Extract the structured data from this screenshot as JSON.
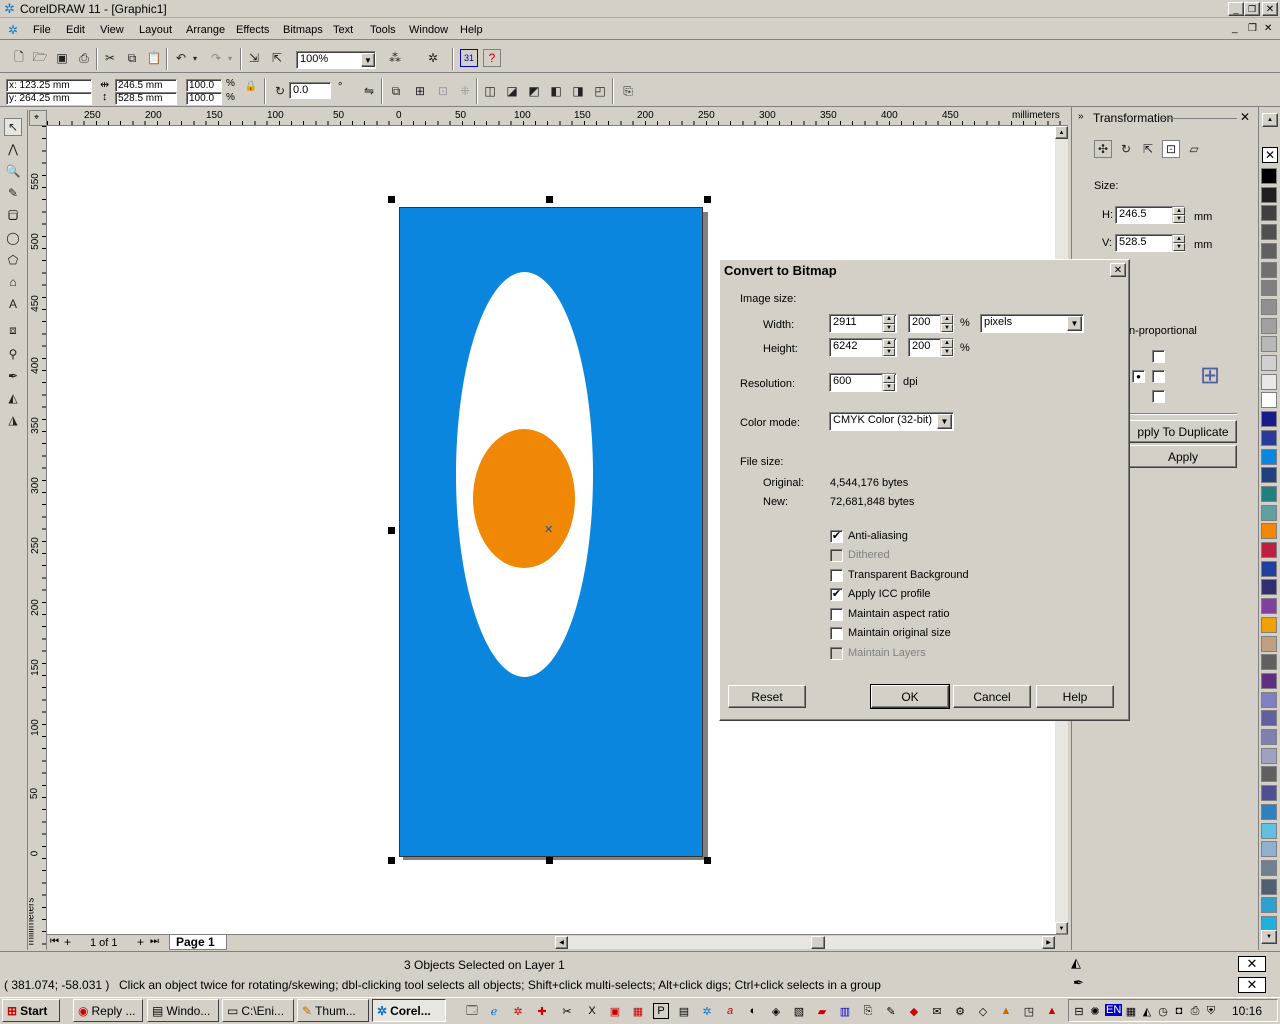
{
  "app": {
    "title": "CorelDRAW 11 - [Graphic1]"
  },
  "menu": [
    "File",
    "Edit",
    "View",
    "Layout",
    "Arrange",
    "Effects",
    "Bitmaps",
    "Text",
    "Tools",
    "Window",
    "Help"
  ],
  "toolbar": {
    "zoom": "100%"
  },
  "propbar": {
    "x": "x: 123.25 mm",
    "y": "y: 264.25 mm",
    "w": "246.5 mm",
    "h": "528.5 mm",
    "sx": "100.0",
    "sy": "100.0",
    "pct": "%",
    "angle": "0.0",
    "deg": "°"
  },
  "ruler": {
    "units": "millimeters",
    "h_ticks": [
      "250",
      "200",
      "150",
      "100",
      "50",
      "0",
      "50",
      "100",
      "150",
      "200",
      "250",
      "300",
      "350",
      "400",
      "450"
    ],
    "v_ticks": [
      "550",
      "500",
      "450",
      "400",
      "350",
      "300",
      "250",
      "200",
      "150",
      "100",
      "50",
      "0"
    ]
  },
  "pages": {
    "count": "1 of 1",
    "current": "Page 1"
  },
  "docker": {
    "title": "Transformation",
    "size_label": "Size:",
    "h_label": "H:",
    "h_value": "246.5",
    "v_label": "V:",
    "v_value": "528.5",
    "unit": "mm",
    "nonprop": "n-proportional",
    "apply_dup": "pply To Duplicate",
    "apply": "Apply"
  },
  "dialog": {
    "title": "Convert to Bitmap",
    "image_size": "Image size:",
    "width_label": "Width:",
    "width_value": "2911",
    "width_pct": "200",
    "height_label": "Height:",
    "height_value": "6242",
    "height_pct": "200",
    "pct": "%",
    "units": "pixels",
    "res_label": "Resolution:",
    "res_value": "600",
    "dpi": "dpi",
    "mode_label": "Color mode:",
    "mode_value": "CMYK Color (32-bit)",
    "file_size": "File size:",
    "orig_label": "Original:",
    "orig_value": "4,544,176 bytes",
    "new_label": "New:",
    "new_value": "72,681,848 bytes",
    "options": [
      {
        "label": "Anti-aliasing",
        "checked": true,
        "disabled": false
      },
      {
        "label": "Dithered",
        "checked": false,
        "disabled": true
      },
      {
        "label": "Transparent Background",
        "checked": false,
        "disabled": false
      },
      {
        "label": "Apply ICC profile",
        "checked": true,
        "disabled": false
      },
      {
        "label": "Maintain aspect ratio",
        "checked": false,
        "disabled": false
      },
      {
        "label": "Maintain original size",
        "checked": false,
        "disabled": false
      },
      {
        "label": "Maintain Layers",
        "checked": false,
        "disabled": true
      }
    ],
    "reset": "Reset",
    "ok": "OK",
    "cancel": "Cancel",
    "help": "Help"
  },
  "status": {
    "selection": "3 Objects Selected on Layer 1",
    "coords": "( 381.074; -58.031 )",
    "hint": "Click an object twice for rotating/skewing; dbl-clicking tool selects all objects; Shift+click multi-selects; Alt+click digs; Ctrl+click selects in a group"
  },
  "taskbar": {
    "start": "Start",
    "tasks": [
      "Reply ...",
      "Windo...",
      "C:\\Eni...",
      "Thum...",
      "Corel..."
    ],
    "lang": "EN",
    "clock": "10:16"
  },
  "colors": {
    "page_blue": "#0a86de",
    "orange": "#f08705",
    "titlebar": "#d4d0c8"
  }
}
